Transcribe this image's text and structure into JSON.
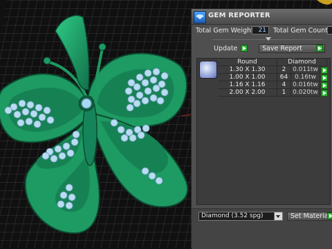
{
  "panel": {
    "title": "GEM REPORTER",
    "total_weight_label": "Total Gem Weight",
    "total_weight_value": "21",
    "total_count_label": "Total Gem Count",
    "update_label": "Update",
    "save_report_label": "Save Report",
    "table": {
      "headers": [
        "Round",
        "Diamond"
      ],
      "rows": [
        {
          "size": "1.30 X 1.30",
          "count": "2",
          "weight": "0.011tw"
        },
        {
          "size": "1.00 X 1.00",
          "count": "64",
          "weight": "0.16tw"
        },
        {
          "size": "1.16 X 1.16",
          "count": "4",
          "weight": "0.016tw"
        },
        {
          "size": "2.00 X 2.00",
          "count": "1",
          "weight": "0.020tw"
        }
      ]
    },
    "material_select": "Diamond   (3.52 spg)",
    "set_material_label": "Set Material"
  },
  "colors": {
    "jewelry": "#1e9a63",
    "grid": "#2d2d2d",
    "gems": "#b8dcf2"
  }
}
